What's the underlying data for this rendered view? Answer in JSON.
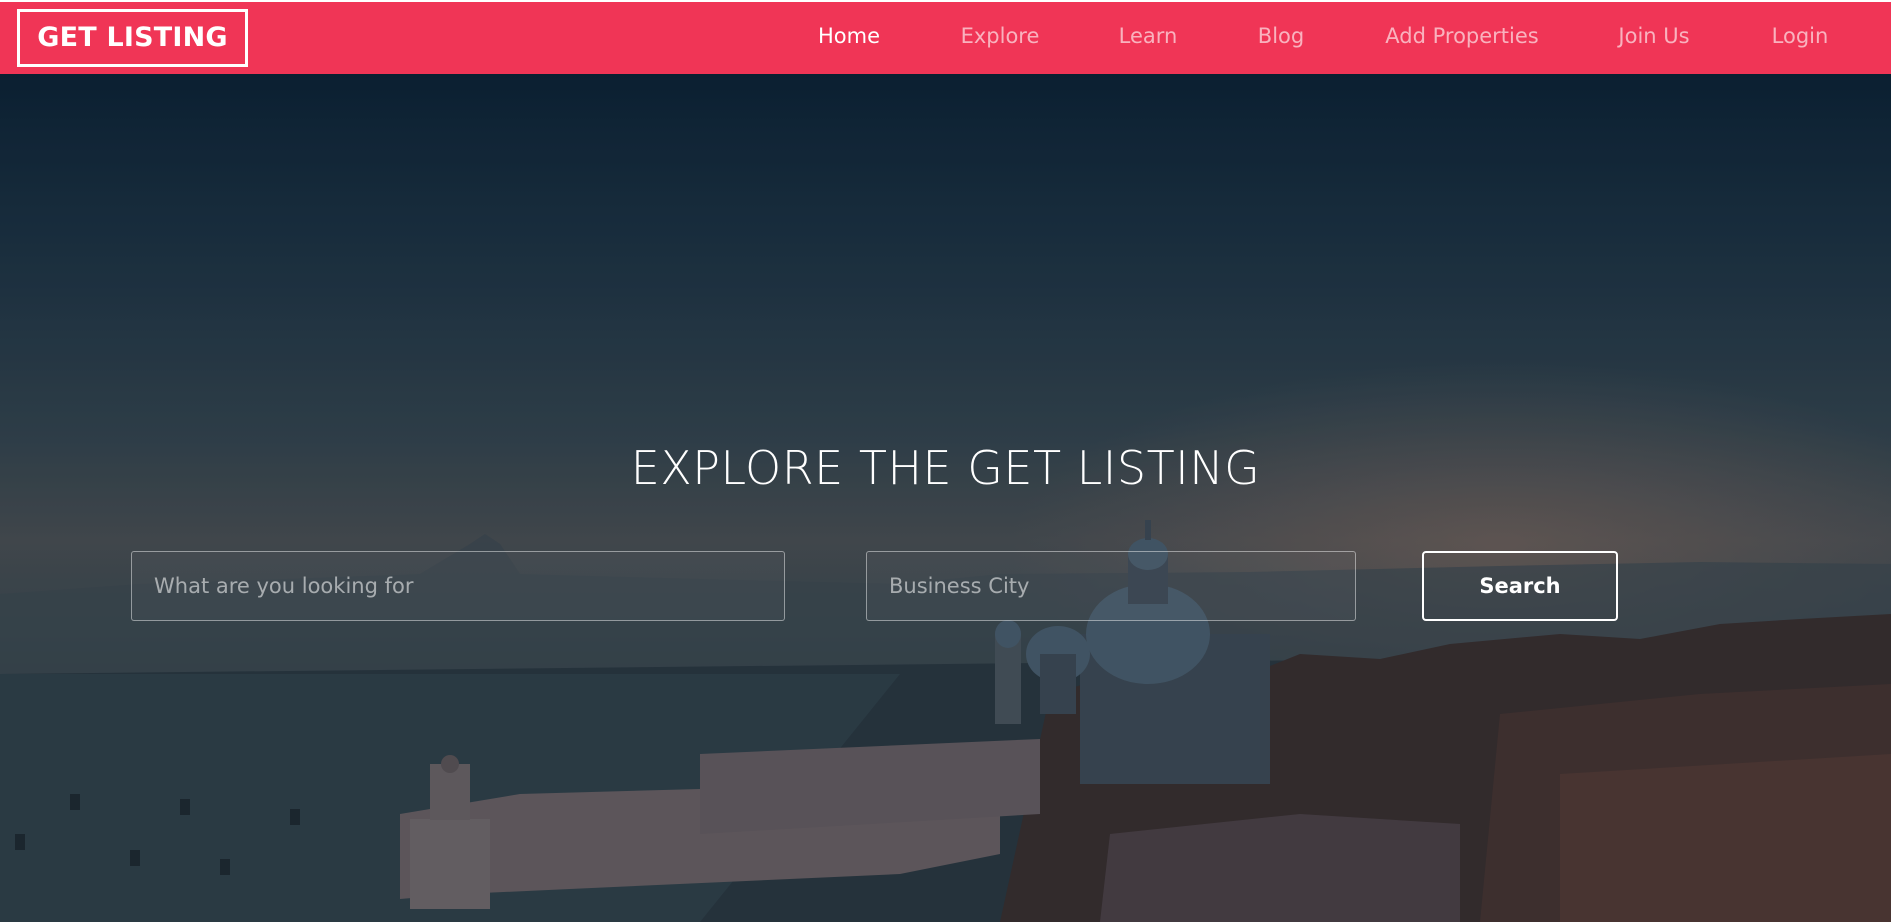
{
  "brand": {
    "logo_text": "GET LISTING"
  },
  "nav": {
    "items": [
      {
        "label": "Home",
        "active": true
      },
      {
        "label": "Explore",
        "active": false
      },
      {
        "label": "Learn",
        "active": false
      },
      {
        "label": "Blog",
        "active": false
      },
      {
        "label": "Add Properties",
        "active": false
      },
      {
        "label": "Join Us",
        "active": false
      },
      {
        "label": "Login",
        "active": false
      }
    ]
  },
  "hero": {
    "title": "EXPLORE THE GET LISTING",
    "search": {
      "keyword_placeholder": "What are you looking for",
      "keyword_value": "",
      "city_placeholder": "Business City",
      "city_value": "",
      "button_label": "Search"
    }
  },
  "colors": {
    "navbar": "#f03556",
    "nav_text": "#ffffff",
    "hero_overlay": "#13222f"
  }
}
